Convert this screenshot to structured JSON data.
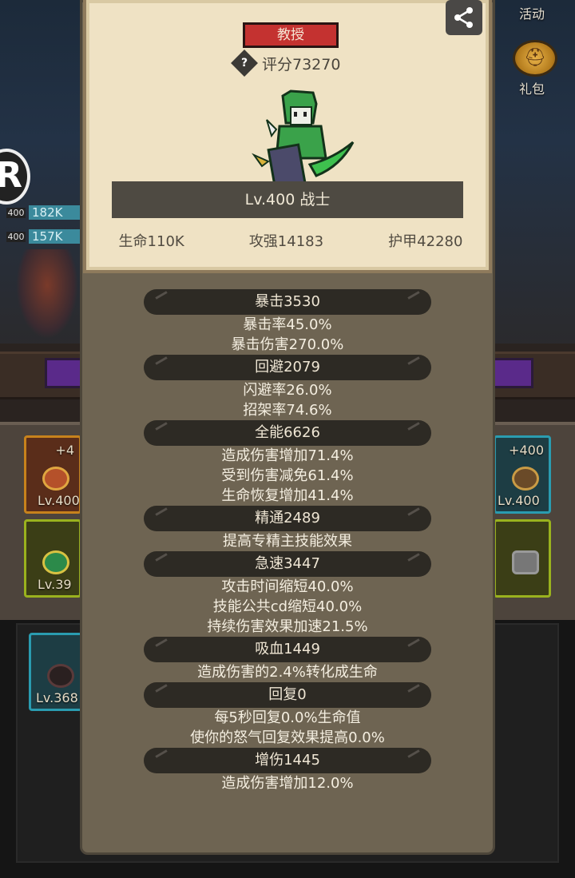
{
  "side": {
    "activity_label": "活动",
    "gift_label": "礼包",
    "hp_rows": [
      {
        "level": "400",
        "hp": "182K"
      },
      {
        "level": "400",
        "hp": "157K"
      }
    ],
    "big_letter": "R"
  },
  "equipment_slots": [
    {
      "level": "Lv.400",
      "plus": "+4"
    },
    {
      "level": "Lv.39",
      "plus": ""
    },
    {
      "level": "Lv.400",
      "plus": "+400"
    },
    {
      "level": "Lv.368",
      "plus": ""
    }
  ],
  "card": {
    "title": "教授",
    "score_label": "评分73270",
    "class_label": "Lv.400 战士",
    "stats": [
      {
        "text": "生命110K"
      },
      {
        "text": "攻强14183"
      },
      {
        "text": "护甲42280"
      }
    ]
  },
  "attributes": [
    {
      "header": "暴击3530",
      "lines": [
        "暴击率45.0%",
        "暴击伤害270.0%"
      ]
    },
    {
      "header": "回避2079",
      "lines": [
        "闪避率26.0%",
        "招架率74.6%"
      ]
    },
    {
      "header": "全能6626",
      "lines": [
        "造成伤害增加71.4%",
        "受到伤害减免61.4%",
        "生命恢复增加41.4%"
      ]
    },
    {
      "header": "精通2489",
      "lines": [
        "提高专精主技能效果"
      ]
    },
    {
      "header": "急速3447",
      "lines": [
        "攻击时间缩短40.0%",
        "技能公共cd缩短40.0%",
        "持续伤害效果加速21.5%"
      ]
    },
    {
      "header": "吸血1449",
      "lines": [
        "造成伤害的2.4%转化成生命"
      ]
    },
    {
      "header": "回复0",
      "lines": [
        "每5秒回复0.0%生命值",
        "使你的怒气回复效果提高0.0%"
      ]
    },
    {
      "header": "增伤1445",
      "lines": [
        "造成伤害增加12.0%"
      ]
    }
  ]
}
